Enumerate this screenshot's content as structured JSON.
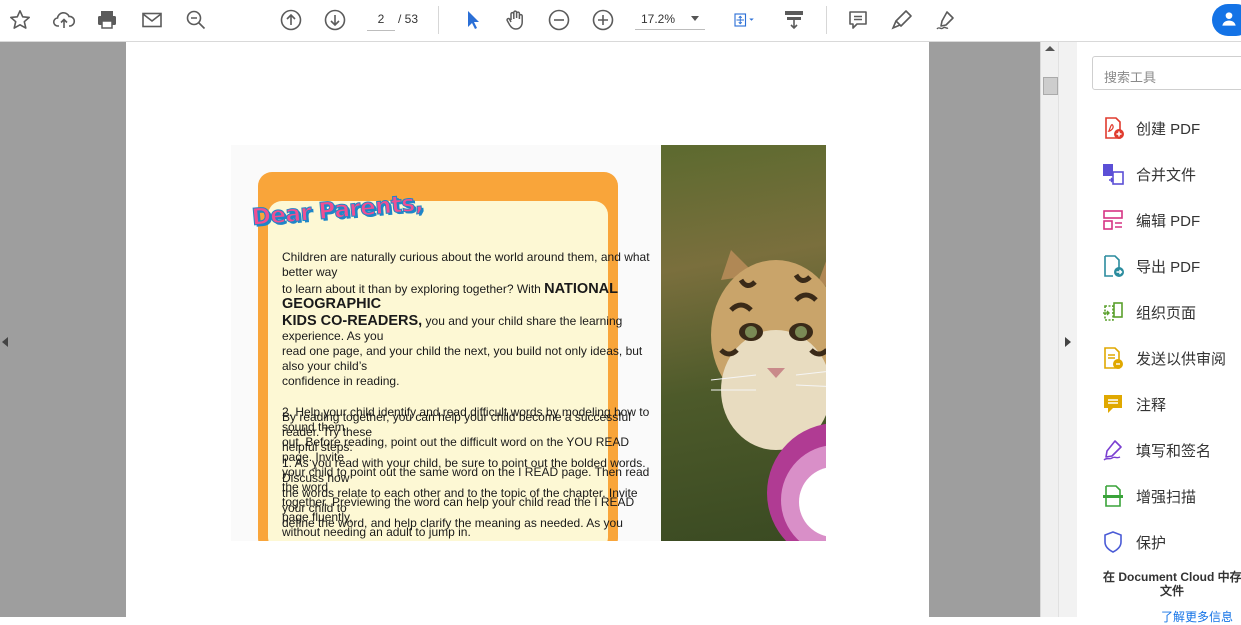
{
  "toolbar": {
    "page_current": "2",
    "page_total": "/ 53",
    "zoom": "17.2%"
  },
  "document": {
    "heading": "Dear Parents,",
    "p1_a": "Children are naturally curious about the world around them, and what better way",
    "p1_b": "to learn about it than by exploring together? With ",
    "p1_b_bold": "NATIONAL GEOGRAPHIC",
    "p1_c_bold": "KIDS CO-READERS,",
    "p1_c": " you and your child share the learning experience. As you",
    "p1_d": "read one page, and your child the next, you build not only ideas, but also your child’s",
    "p1_e": "confidence in reading.",
    "ov_1": "2. Help your child identify and read difficult words by modeling how to sound them",
    "ov_2": "By reading together, you can help your child become a successful reader. Try these",
    "ov_3": "out. Before reading, point out the difficult word on the YOU READ page. Invite",
    "ov_4": "helpful steps:",
    "ov_5": "1. As you read with your child, be sure to point out the bolded words. Discuss how",
    "ov_6": "your child to point out the same word on the I READ page. Then read the word",
    "ov_7": "the words relate to each other and to the topic of the chapter. Invite your child to",
    "ov_8": "together. Previewing the word can help your child read the I READ page fluently,",
    "ov_9": "define the word, and help clarify the meaning as needed. As you",
    "ov_10": "without needing an adult to jump in."
  },
  "panel": {
    "search_placeholder": "搜索工具",
    "tools": [
      {
        "label": "创建 PDF",
        "icon": "create-pdf-icon",
        "color": "#e03b2e"
      },
      {
        "label": "合并文件",
        "icon": "combine-files-icon",
        "color": "#5b4fd6"
      },
      {
        "label": "编辑 PDF",
        "icon": "edit-pdf-icon",
        "color": "#d63384"
      },
      {
        "label": "导出 PDF",
        "icon": "export-pdf-icon",
        "color": "#2b8c9e"
      },
      {
        "label": "组织页面",
        "icon": "organize-pages-icon",
        "color": "#5aa02c"
      },
      {
        "label": "发送以供审阅",
        "icon": "send-review-icon",
        "color": "#e0a800"
      },
      {
        "label": "注释",
        "icon": "comment-icon",
        "color": "#e0a800"
      },
      {
        "label": "填写和签名",
        "icon": "fill-sign-icon",
        "color": "#7a3fd1"
      },
      {
        "label": "增强扫描",
        "icon": "enhance-scan-icon",
        "color": "#3aa33a"
      },
      {
        "label": "保护",
        "icon": "protect-icon",
        "color": "#4a5bd6"
      }
    ],
    "dc_line1": "在 Document Cloud 中存",
    "dc_line2": "文件",
    "learn_more": "了解更多信息"
  },
  "colors": {
    "accent": "#1473e6",
    "cursor_blue": "#2b6fd6"
  }
}
